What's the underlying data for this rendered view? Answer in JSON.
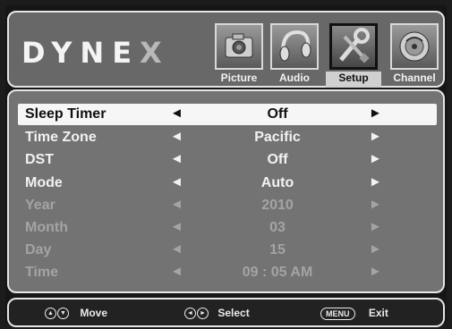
{
  "brand": {
    "logo_main": "DYNE",
    "logo_x": "X"
  },
  "tabs": [
    {
      "label": "Picture",
      "icon": "camera-icon",
      "selected": false
    },
    {
      "label": "Audio",
      "icon": "headphones-icon",
      "selected": false
    },
    {
      "label": "Setup",
      "icon": "tools-icon",
      "selected": true
    },
    {
      "label": "Channel",
      "icon": "satellite-dish-icon",
      "selected": false
    }
  ],
  "menu": [
    {
      "label": "Sleep Timer",
      "value": "Off",
      "state": "highlighted"
    },
    {
      "label": "Time Zone",
      "value": "Pacific",
      "state": "normal"
    },
    {
      "label": "DST",
      "value": "Off",
      "state": "normal"
    },
    {
      "label": "Mode",
      "value": "Auto",
      "state": "normal"
    },
    {
      "label": "Year",
      "value": "2010",
      "state": "disabled"
    },
    {
      "label": "Month",
      "value": "03",
      "state": "disabled"
    },
    {
      "label": "Day",
      "value": "15",
      "state": "disabled"
    },
    {
      "label": "Time",
      "value": "09 : 05  AM",
      "state": "disabled"
    }
  ],
  "arrows": {
    "left": "◄",
    "right": "►"
  },
  "footer": {
    "move_label": "Move",
    "select_label": "Select",
    "menu_key": "MENU",
    "exit_label": "Exit"
  }
}
